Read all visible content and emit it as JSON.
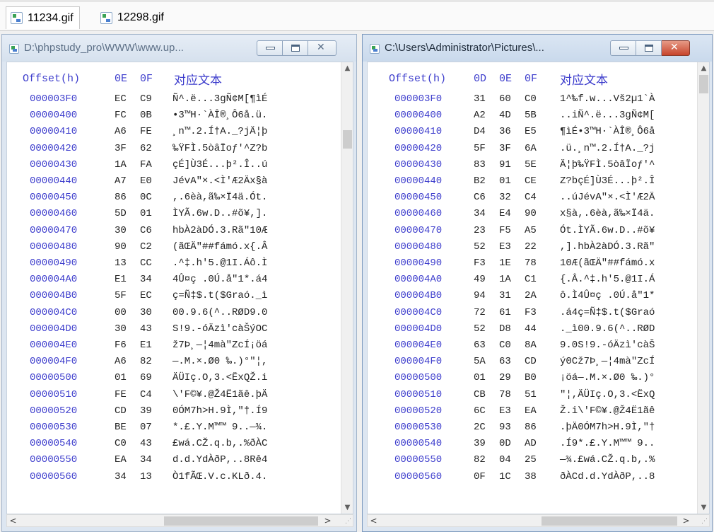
{
  "tabs": [
    {
      "label": "11234.gif",
      "active": true,
      "icon": "gif-file-icon"
    },
    {
      "label": "12298.gif",
      "active": false,
      "icon": "gif-file-icon"
    }
  ],
  "left_panel": {
    "title": "D:\\phpstudy_pro\\WWW\\www.up...",
    "columns": {
      "offset": "Offset(h)",
      "bytes": [
        "0E",
        "0F"
      ],
      "text": "对应文本"
    },
    "rows": [
      {
        "offset": "000003F0",
        "bytes": [
          "EC",
          "C9"
        ],
        "text": "Ñ^.ë...3gÑ¢M[¶ìÉ"
      },
      {
        "offset": "00000400",
        "bytes": [
          "FC",
          "0B"
        ],
        "text": "•3™H·`ÀÎ®¸Ô6å.ü."
      },
      {
        "offset": "00000410",
        "bytes": [
          "A6",
          "FE"
        ],
        "text": "¸n™.2.Í†A._?jÄ¦þ"
      },
      {
        "offset": "00000420",
        "bytes": [
          "3F",
          "62"
        ],
        "text": "‰ŸFÌ.5òâÏoƒ'^Z?b"
      },
      {
        "offset": "00000430",
        "bytes": [
          "1A",
          "FA"
        ],
        "text": "çÉ]Ù3É...þ².Î..ú"
      },
      {
        "offset": "00000440",
        "bytes": [
          "A7",
          "E0"
        ],
        "text": "JévA\"×.<Ì'Æ2Äx§à"
      },
      {
        "offset": "00000450",
        "bytes": [
          "86",
          "0C"
        ],
        "text": ",.6èà,ã‰×Ï4ä.Ót."
      },
      {
        "offset": "00000460",
        "bytes": [
          "5D",
          "01"
        ],
        "text": "ÌYÃ.6w.D..#õ¥,]."
      },
      {
        "offset": "00000470",
        "bytes": [
          "30",
          "C6"
        ],
        "text": "hbÀ2àDÓ.3.Rã\"10Æ"
      },
      {
        "offset": "00000480",
        "bytes": [
          "90",
          "C2"
        ],
        "text": "(ãŒÄ\"##fámó.x{.Â"
      },
      {
        "offset": "00000490",
        "bytes": [
          "13",
          "CC"
        ],
        "text": ".^‡.h'5.@1I.Áô.Ì"
      },
      {
        "offset": "000004A0",
        "bytes": [
          "E1",
          "34"
        ],
        "text": "4Û¤ç .0Ú.å\"1*.á4"
      },
      {
        "offset": "000004B0",
        "bytes": [
          "5F",
          "EC"
        ],
        "text": "ç=Ñ‡$.t($Graó._ì"
      },
      {
        "offset": "000004C0",
        "bytes": [
          "00",
          "30"
        ],
        "text": "00.9.6(^..RØD9.0"
      },
      {
        "offset": "000004D0",
        "bytes": [
          "30",
          "43"
        ],
        "text": "S!9.-óÄzì'càŠýOC"
      },
      {
        "offset": "000004E0",
        "bytes": [
          "F6",
          "E1"
        ],
        "text": "ž7Þ¸—¦4mà\"ZcÍ¡öá"
      },
      {
        "offset": "000004F0",
        "bytes": [
          "A6",
          "82"
        ],
        "text": "—.M.×.Ø0 ‰.)°\"¦,"
      },
      {
        "offset": "00000500",
        "bytes": [
          "01",
          "69"
        ],
        "text": "ÄÜIç.O,3.<ËxQŽ.i"
      },
      {
        "offset": "00000510",
        "bytes": [
          "FE",
          "C4"
        ],
        "text": "\\'F©¥.@Ž4Ë1ãê.þÄ"
      },
      {
        "offset": "00000520",
        "bytes": [
          "CD",
          "39"
        ],
        "text": "0ÓM7h>H.9Ì,\"†.Í9"
      },
      {
        "offset": "00000530",
        "bytes": [
          "BE",
          "07"
        ],
        "text": "*.£.Y.M™™ 9..—¾."
      },
      {
        "offset": "00000540",
        "bytes": [
          "C0",
          "43"
        ],
        "text": "£wá.CŽ.q.b,.%ðÀC"
      },
      {
        "offset": "00000550",
        "bytes": [
          "EA",
          "34"
        ],
        "text": "d.d.YdÀðP,..8Rê4"
      },
      {
        "offset": "00000560",
        "bytes": [
          "34",
          "13"
        ],
        "text": "Ò1fÃŒ.V.c.KLð.4."
      }
    ]
  },
  "right_panel": {
    "title": "C:\\Users\\Administrator\\Pictures\\...",
    "columns": {
      "offset": "Offset(h)",
      "bytes": [
        "0D",
        "0E",
        "0F"
      ],
      "text": "对应文本"
    },
    "rows": [
      {
        "offset": "000003F0",
        "bytes": [
          "31",
          "60",
          "C0"
        ],
        "text": "1^‰f.w...Vš2µ1`À"
      },
      {
        "offset": "00000400",
        "bytes": [
          "A2",
          "4D",
          "5B"
        ],
        "text": "..iÑ^.ë...3gÑ¢M["
      },
      {
        "offset": "00000410",
        "bytes": [
          "D4",
          "36",
          "E5"
        ],
        "text": "¶ìÉ•3™H·`ÀÎ®¸Ô6å"
      },
      {
        "offset": "00000420",
        "bytes": [
          "5F",
          "3F",
          "6A"
        ],
        "text": ".ü.¸n™.2.Í†A._?j"
      },
      {
        "offset": "00000430",
        "bytes": [
          "83",
          "91",
          "5E"
        ],
        "text": "Ä¦þ‰ŸFÌ.5òâÏoƒ'^"
      },
      {
        "offset": "00000440",
        "bytes": [
          "B2",
          "01",
          "CE"
        ],
        "text": "Z?bçÉ]Ù3É...þ².Î"
      },
      {
        "offset": "00000450",
        "bytes": [
          "C6",
          "32",
          "C4"
        ],
        "text": "..úJévA\"×.<Ì'Æ2Ä"
      },
      {
        "offset": "00000460",
        "bytes": [
          "34",
          "E4",
          "90"
        ],
        "text": "x§à,.6èà,ã‰×Ï4ä."
      },
      {
        "offset": "00000470",
        "bytes": [
          "23",
          "F5",
          "A5"
        ],
        "text": "Ót.ÌYÃ.6w.D..#õ¥"
      },
      {
        "offset": "00000480",
        "bytes": [
          "52",
          "E3",
          "22"
        ],
        "text": ",].hbÀ2àDÓ.3.Rã\""
      },
      {
        "offset": "00000490",
        "bytes": [
          "F3",
          "1E",
          "78"
        ],
        "text": "10Æ(ãŒÄ\"##fámó.x"
      },
      {
        "offset": "000004A0",
        "bytes": [
          "49",
          "1A",
          "C1"
        ],
        "text": "{.Â.^‡.h'5.@1I.Á"
      },
      {
        "offset": "000004B0",
        "bytes": [
          "94",
          "31",
          "2A"
        ],
        "text": "ô.Ì4Û¤ç .0Ú.å\"1*"
      },
      {
        "offset": "000004C0",
        "bytes": [
          "72",
          "61",
          "F3"
        ],
        "text": ".á4ç=Ñ‡$.t($Graó"
      },
      {
        "offset": "000004D0",
        "bytes": [
          "52",
          "D8",
          "44"
        ],
        "text": "._ì00.9.6(^..RØD"
      },
      {
        "offset": "000004E0",
        "bytes": [
          "63",
          "C0",
          "8A"
        ],
        "text": "9.0S!9.-óÄzì'càŠ"
      },
      {
        "offset": "000004F0",
        "bytes": [
          "5A",
          "63",
          "CD"
        ],
        "text": "ý0Cž7Þ¸—¦4mà\"ZcÍ"
      },
      {
        "offset": "00000500",
        "bytes": [
          "01",
          "29",
          "B0"
        ],
        "text": "¡öá—.M.×.Ø0 ‰.)°"
      },
      {
        "offset": "00000510",
        "bytes": [
          "CB",
          "78",
          "51"
        ],
        "text": "\"¦,ÄÜIç.O,3.<ËxQ"
      },
      {
        "offset": "00000520",
        "bytes": [
          "6C",
          "E3",
          "EA"
        ],
        "text": "Ž.i\\'F©¥.@Ž4Ë1ãê"
      },
      {
        "offset": "00000530",
        "bytes": [
          "2C",
          "93",
          "86"
        ],
        "text": ".þÄ0ÓM7h>H.9Ì,\"†"
      },
      {
        "offset": "00000540",
        "bytes": [
          "39",
          "0D",
          "AD"
        ],
        "text": ".Í9*.£.Y.M™™ 9.."
      },
      {
        "offset": "00000550",
        "bytes": [
          "82",
          "04",
          "25"
        ],
        "text": "—¾.£wá.CŽ.q.b,.%"
      },
      {
        "offset": "00000560",
        "bytes": [
          "0F",
          "1C",
          "38"
        ],
        "text": "ðÀCd.d.YdÀðP,..8"
      }
    ]
  },
  "scroll_glyphs": {
    "up": "▲",
    "down": "▼",
    "left": "<",
    "right": ">",
    "grip": "⋰",
    "close": "✕"
  }
}
